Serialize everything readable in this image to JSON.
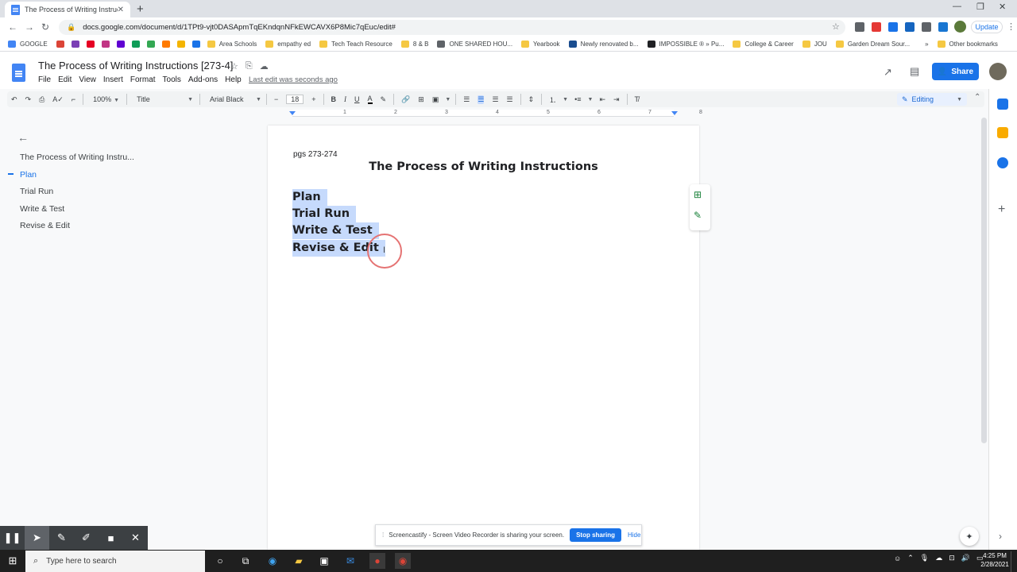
{
  "browser": {
    "tab_title": "The Process of Writing Instructio",
    "url": "docs.google.com/document/d/1TPt9-vjt0DASApmTqEKndqnNFkEWCAVX6P8Mic7qEuc/edit#",
    "update_label": "Update",
    "bookmarks": [
      {
        "label": "GOOGLE",
        "color": "#4285f4"
      },
      {
        "label": "",
        "color": "#db4437"
      },
      {
        "label": "",
        "color": "#7b3fb5"
      },
      {
        "label": "",
        "color": "#e60023"
      },
      {
        "label": "",
        "color": "#c13584"
      },
      {
        "label": "",
        "color": "#6001d2"
      },
      {
        "label": "",
        "color": "#0f9d58"
      },
      {
        "label": "",
        "color": "#34a853"
      },
      {
        "label": "",
        "color": "#ff7a00"
      },
      {
        "label": "",
        "color": "#f4b400"
      },
      {
        "label": "",
        "color": "#1a73e8"
      },
      {
        "label": "Area Schools",
        "color": "#f5c842"
      },
      {
        "label": "empathy ed",
        "color": "#f5c842"
      },
      {
        "label": "Tech Teach Resource",
        "color": "#f5c842"
      },
      {
        "label": "8 & B",
        "color": "#f5c842"
      },
      {
        "label": "ONE SHARED HOU...",
        "color": "#5f6368"
      },
      {
        "label": "Yearbook",
        "color": "#f5c842"
      },
      {
        "label": "Newly renovated b...",
        "color": "#1a4d8f"
      },
      {
        "label": "IMPOSSIBLE ® » Pu...",
        "color": "#202124"
      },
      {
        "label": "College & Career",
        "color": "#f5c842"
      },
      {
        "label": "JOU",
        "color": "#f5c842"
      },
      {
        "label": "Garden Dream Sour...",
        "color": "#f5c842"
      }
    ],
    "bookmarks_more": "»",
    "other_bookmarks": "Other bookmarks"
  },
  "docs": {
    "title": "The Process of Writing Instructions [273-4]",
    "menu": [
      "File",
      "Edit",
      "View",
      "Insert",
      "Format",
      "Tools",
      "Add-ons",
      "Help"
    ],
    "last_edit": "Last edit was seconds ago",
    "share_label": "Share",
    "toolbar": {
      "zoom": "100%",
      "style": "Title",
      "font": "Arial Black",
      "font_size": "18"
    },
    "mode": "Editing",
    "ruler_ticks": [
      "1",
      "2",
      "3",
      "4",
      "5",
      "6",
      "7",
      "8"
    ]
  },
  "outline": {
    "items": [
      "The Process of Writing Instru...",
      "Plan",
      "Trial Run",
      "Write & Test",
      "Revise & Edit"
    ],
    "active_index": 1
  },
  "document": {
    "page_ref": "pgs 273-274",
    "heading": "The Process of Writing Instructions",
    "selected_lines": [
      "Plan",
      "Trial Run",
      "Write & Test",
      "Revise & Edit"
    ]
  },
  "screencastify": {
    "message": "Screencastify - Screen Video Recorder is sharing your screen.",
    "stop_label": "Stop sharing",
    "hide_label": "Hide"
  },
  "taskbar": {
    "search_placeholder": "Type here to search",
    "time": "4:25 PM",
    "date": "2/28/2021"
  }
}
